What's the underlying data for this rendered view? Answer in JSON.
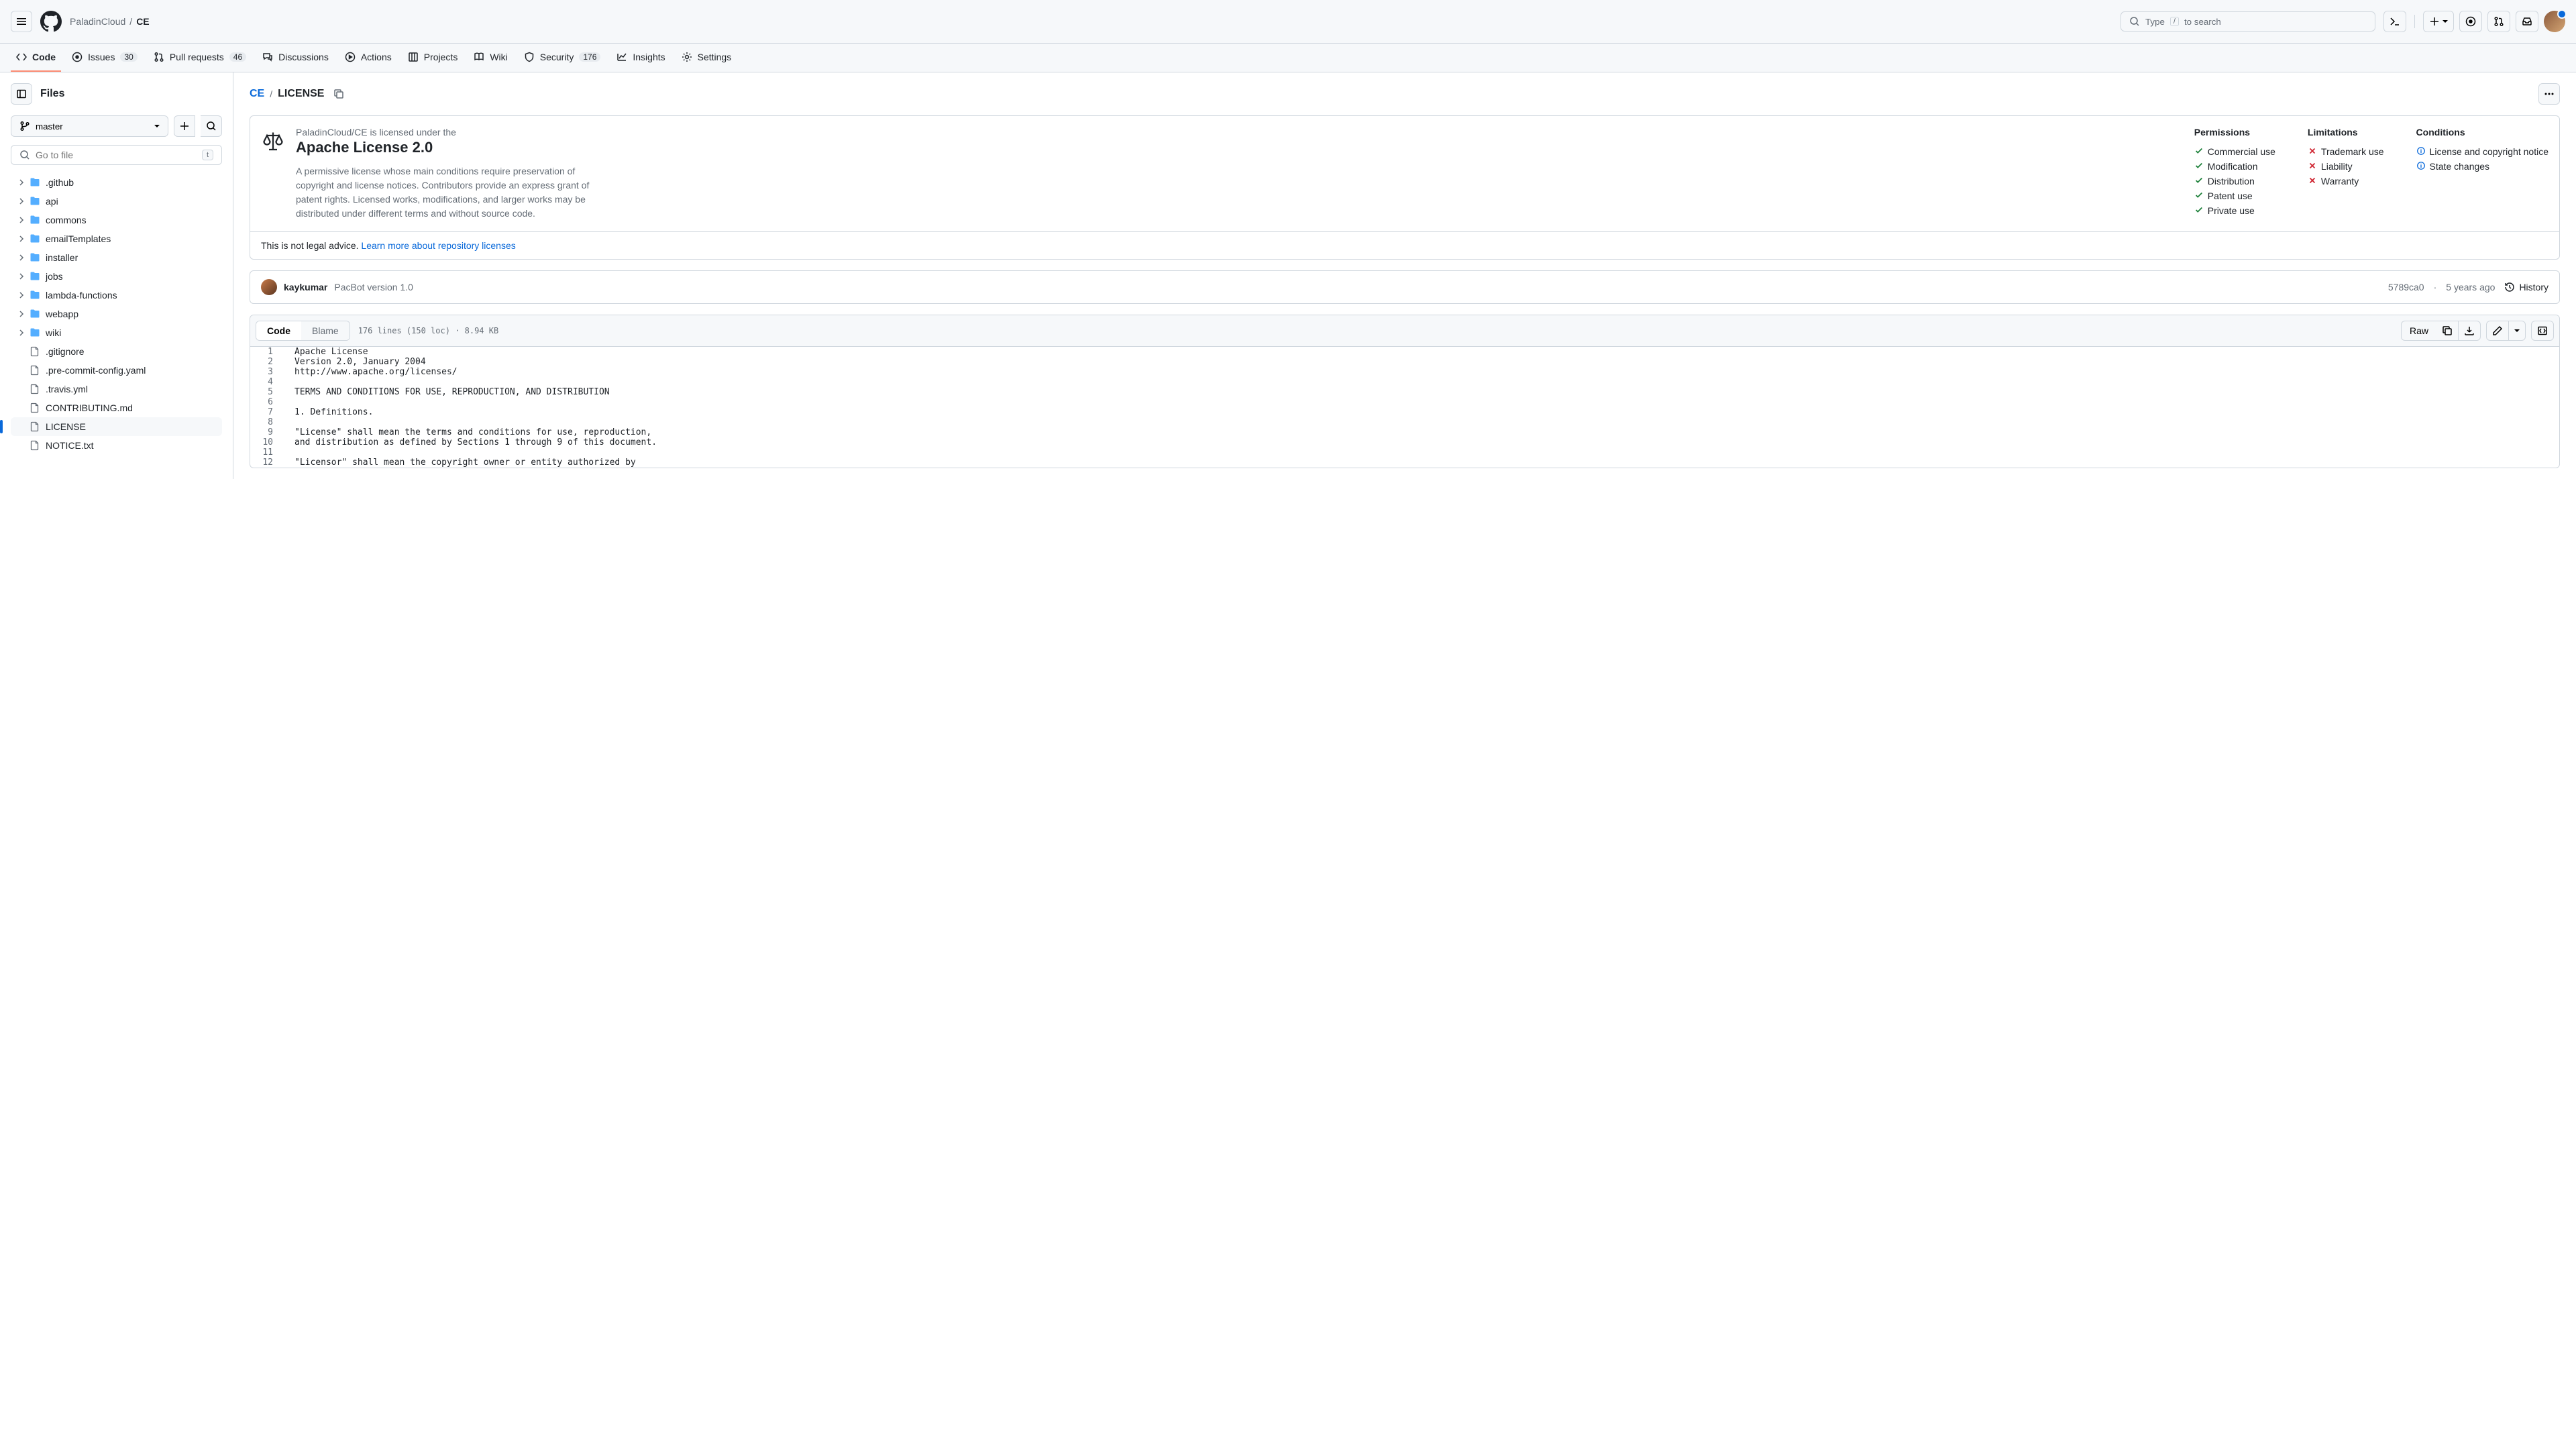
{
  "header": {
    "owner": "PaladinCloud",
    "repo": "CE",
    "search_prefix": "Type",
    "search_suffix": "to search",
    "slash": "/"
  },
  "repoNav": {
    "code": "Code",
    "issues": "Issues",
    "issues_count": "30",
    "pulls": "Pull requests",
    "pulls_count": "46",
    "discussions": "Discussions",
    "actions": "Actions",
    "projects": "Projects",
    "wiki": "Wiki",
    "security": "Security",
    "security_count": "176",
    "insights": "Insights",
    "settings": "Settings"
  },
  "sidebar": {
    "title": "Files",
    "branch": "master",
    "filter_placeholder": "Go to file",
    "filter_kbd": "t",
    "tree": [
      {
        "type": "folder",
        "name": ".github"
      },
      {
        "type": "folder",
        "name": "api"
      },
      {
        "type": "folder",
        "name": "commons"
      },
      {
        "type": "folder",
        "name": "emailTemplates"
      },
      {
        "type": "folder",
        "name": "installer"
      },
      {
        "type": "folder",
        "name": "jobs"
      },
      {
        "type": "folder",
        "name": "lambda-functions"
      },
      {
        "type": "folder",
        "name": "webapp"
      },
      {
        "type": "folder",
        "name": "wiki"
      },
      {
        "type": "file",
        "name": ".gitignore"
      },
      {
        "type": "file",
        "name": ".pre-commit-config.yaml"
      },
      {
        "type": "file",
        "name": ".travis.yml"
      },
      {
        "type": "file",
        "name": "CONTRIBUTING.md"
      },
      {
        "type": "file",
        "name": "LICENSE",
        "selected": true
      },
      {
        "type": "file",
        "name": "NOTICE.txt"
      }
    ]
  },
  "path": {
    "repo": "CE",
    "sep": "/",
    "file": "LICENSE"
  },
  "license": {
    "sub": "PaladinCloud/CE is licensed under the",
    "name": "Apache License 2.0",
    "desc": "A permissive license whose main conditions require preservation of copyright and license notices. Contributors provide an express grant of patent rights. Licensed works, modifications, and larger works may be distributed under different terms and without source code.",
    "permissions_h": "Permissions",
    "limitations_h": "Limitations",
    "conditions_h": "Conditions",
    "permissions": [
      "Commercial use",
      "Modification",
      "Distribution",
      "Patent use",
      "Private use"
    ],
    "limitations": [
      "Trademark use",
      "Liability",
      "Warranty"
    ],
    "conditions": [
      "License and copyright notice",
      "State changes"
    ],
    "footer_text": "This is not legal advice. ",
    "footer_link": "Learn more about repository licenses"
  },
  "commit": {
    "author": "kaykumar",
    "message": "PacBot version 1.0",
    "sha": "5789ca0",
    "dot": "·",
    "when": "5 years ago",
    "history": "History"
  },
  "file": {
    "code_tab": "Code",
    "blame_tab": "Blame",
    "meta": "176 lines (150 loc) · 8.94 KB",
    "raw": "Raw",
    "lines": [
      "Apache License",
      "Version 2.0, January 2004",
      "http://www.apache.org/licenses/",
      "",
      "TERMS AND CONDITIONS FOR USE, REPRODUCTION, AND DISTRIBUTION",
      "",
      "1. Definitions.",
      "",
      "\"License\" shall mean the terms and conditions for use, reproduction,",
      "and distribution as defined by Sections 1 through 9 of this document.",
      "",
      "\"Licensor\" shall mean the copyright owner or entity authorized by"
    ]
  }
}
